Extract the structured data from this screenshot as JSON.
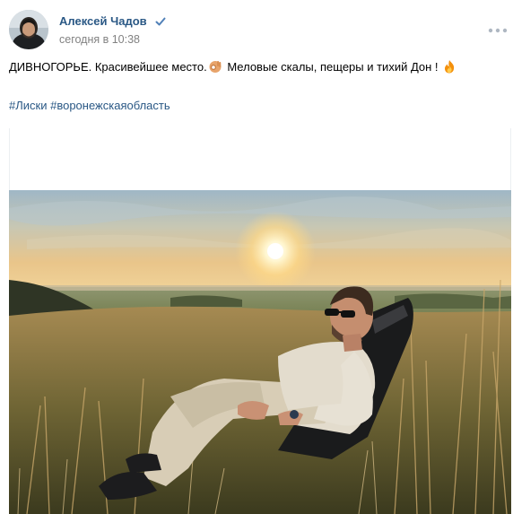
{
  "post": {
    "author": {
      "name": "Алексей Чадов",
      "verified": true,
      "avatar_icon": "avatar-photo"
    },
    "date": "сегодня в 10:38",
    "menu_icon": "more-dots-icon",
    "text_part1": "ДИВНОГОРЬЕ. Красивейшее место.",
    "emoji1": "ok-hand-emoji",
    "text_part2": " Меловые скалы, пещеры и тихий Дон ! ",
    "emoji2": "fire-emoji",
    "hashtags": [
      "#Лиски",
      "#воронежскаяобласть"
    ],
    "photo_icon": "landscape-photo"
  },
  "colors": {
    "link": "#2a5885",
    "meta": "#828282",
    "verified": "#5181b8",
    "menu_dots": "#aeb7c2"
  }
}
